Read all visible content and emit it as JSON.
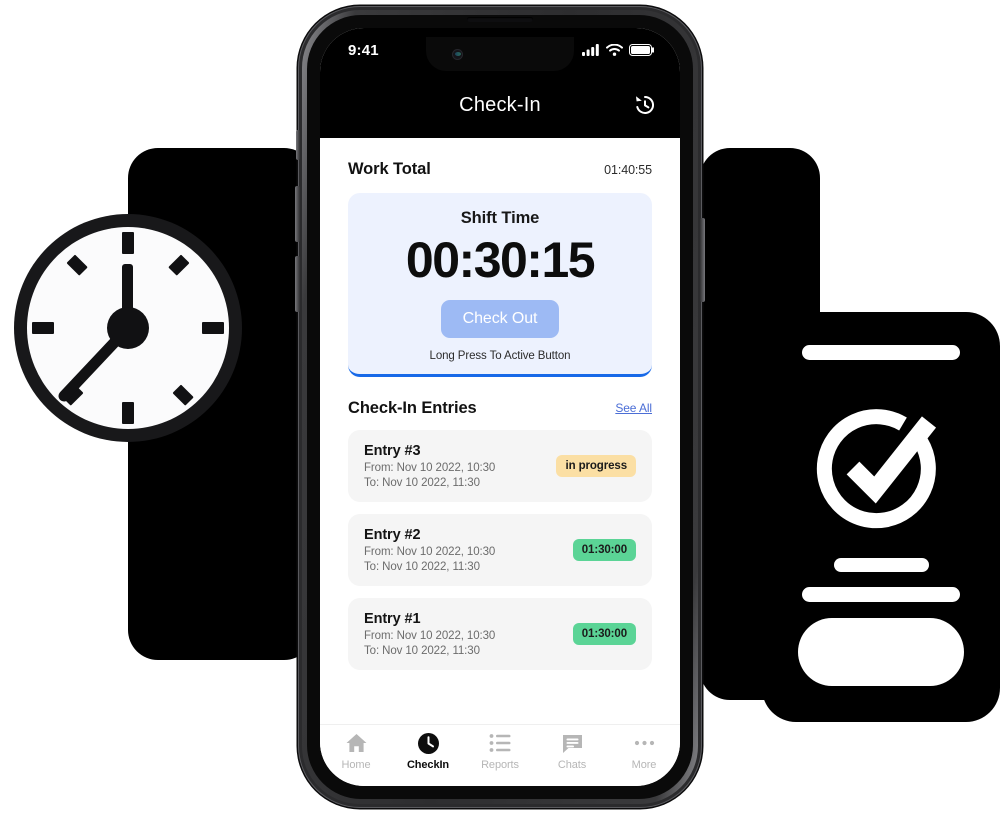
{
  "scene": {
    "back_chevron_icon": "chevron-left-icon"
  },
  "decor": {
    "clock": {
      "icon": "analog-clock-illustration"
    },
    "task_card": {
      "icon": "circle-check-icon"
    }
  },
  "phone": {
    "status_bar": {
      "time": "9:41",
      "cellular_icon": "cellular-signal-icon",
      "wifi_icon": "wifi-icon",
      "battery_icon": "battery-icon"
    },
    "app_bar": {
      "title": "Check-In",
      "action_icon": "history-icon"
    },
    "work_total": {
      "label": "Work Total",
      "value": "01:40:55"
    },
    "shift_card": {
      "label": "Shift Time",
      "timer": "00:30:15",
      "button_label": "Check Out",
      "hint": "Long Press To Active Button",
      "accent_color": "#1769e8",
      "button_color": "#9dbaf4",
      "background_color": "#edf2fe"
    },
    "entries_section": {
      "title": "Check-In Entries",
      "see_all_label": "See All",
      "entries": [
        {
          "title": "Entry #3",
          "from": "From: Nov 10 2022, 10:30",
          "to": "To: Nov 10 2022, 11:30",
          "badge": "in progress",
          "badge_type": "progress",
          "badge_color": "#fbdfa4"
        },
        {
          "title": "Entry #2",
          "from": "From: Nov 10 2022, 10:30",
          "to": "To: Nov 10 2022, 11:30",
          "badge": "01:30:00",
          "badge_type": "duration",
          "badge_color": "#5bd496"
        },
        {
          "title": "Entry #1",
          "from": "From: Nov 10 2022, 10:30",
          "to": "To: Nov 10 2022, 11:30",
          "badge": "01:30:00",
          "badge_type": "duration",
          "badge_color": "#5bd496"
        }
      ]
    },
    "tab_bar": {
      "tabs": [
        {
          "label": "Home",
          "icon": "home-icon",
          "active": false
        },
        {
          "label": "CheckIn",
          "icon": "clock-icon",
          "active": true
        },
        {
          "label": "Reports",
          "icon": "list-icon",
          "active": false
        },
        {
          "label": "Chats",
          "icon": "chat-icon",
          "active": false
        },
        {
          "label": "More",
          "icon": "more-dots-icon",
          "active": false
        }
      ]
    }
  }
}
